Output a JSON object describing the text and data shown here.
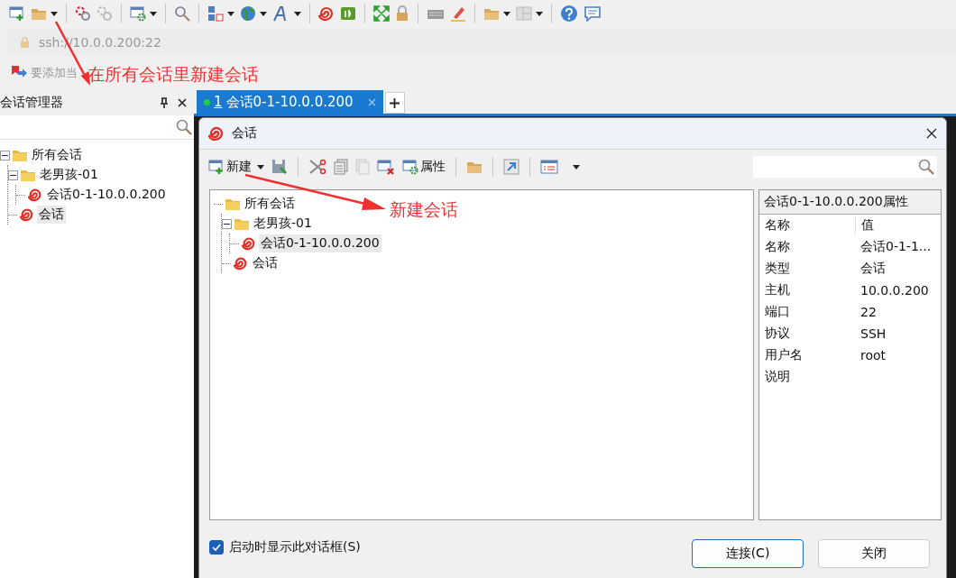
{
  "address_bar": {
    "value": "ssh://10.0.0.200:22"
  },
  "link_bar": {
    "hint": "要添加当"
  },
  "session_manager": {
    "title": "会话管理器",
    "tree": [
      {
        "label": "所有会话",
        "kind": "folder",
        "expanded": true,
        "selected": false,
        "children": [
          {
            "label": "老男孩-01",
            "kind": "folder",
            "expanded": true,
            "selected": false,
            "children": [
              {
                "label": "会话0-1-10.0.0.200",
                "kind": "session",
                "selected": false
              }
            ]
          },
          {
            "label": "会话",
            "kind": "session",
            "selected": true
          }
        ]
      }
    ]
  },
  "tabs": [
    {
      "number": "1",
      "label": "会话0-1-10.0.0.200",
      "selected": true,
      "connected": true
    }
  ],
  "dialog": {
    "title": "会话",
    "toolbar": {
      "new_label": "新建",
      "properties_label": "属性"
    },
    "tree": [
      {
        "label": "所有会话",
        "kind": "folder",
        "selected": false,
        "children": [
          {
            "label": "老男孩-01",
            "kind": "folder",
            "expanded": true,
            "selected": false,
            "children": [
              {
                "label": "会话0-1-10.0.0.200",
                "kind": "session",
                "selected": true
              }
            ]
          },
          {
            "label": "会话",
            "kind": "session",
            "selected": false
          }
        ]
      }
    ],
    "properties": {
      "title": "会话0-1-10.0.0.200属性",
      "columns": [
        "名称",
        "值"
      ],
      "rows": [
        {
          "name": "名称",
          "value": "会话0-1-1..."
        },
        {
          "name": "类型",
          "value": "会话"
        },
        {
          "name": "主机",
          "value": "10.0.0.200"
        },
        {
          "name": "端口",
          "value": "22"
        },
        {
          "name": "协议",
          "value": "SSH"
        },
        {
          "name": "用户名",
          "value": "root"
        },
        {
          "name": "说明"
        }
      ]
    },
    "show_on_startup": {
      "label": "启动时显示此对话框(S)",
      "checked": true
    },
    "buttons": [
      {
        "label": "连接(C)",
        "default": true
      },
      {
        "label": "关闭",
        "default": false
      }
    ]
  },
  "annotations": [
    {
      "text": "在所有会话里新建会话"
    },
    {
      "text": "新建会话"
    }
  ]
}
